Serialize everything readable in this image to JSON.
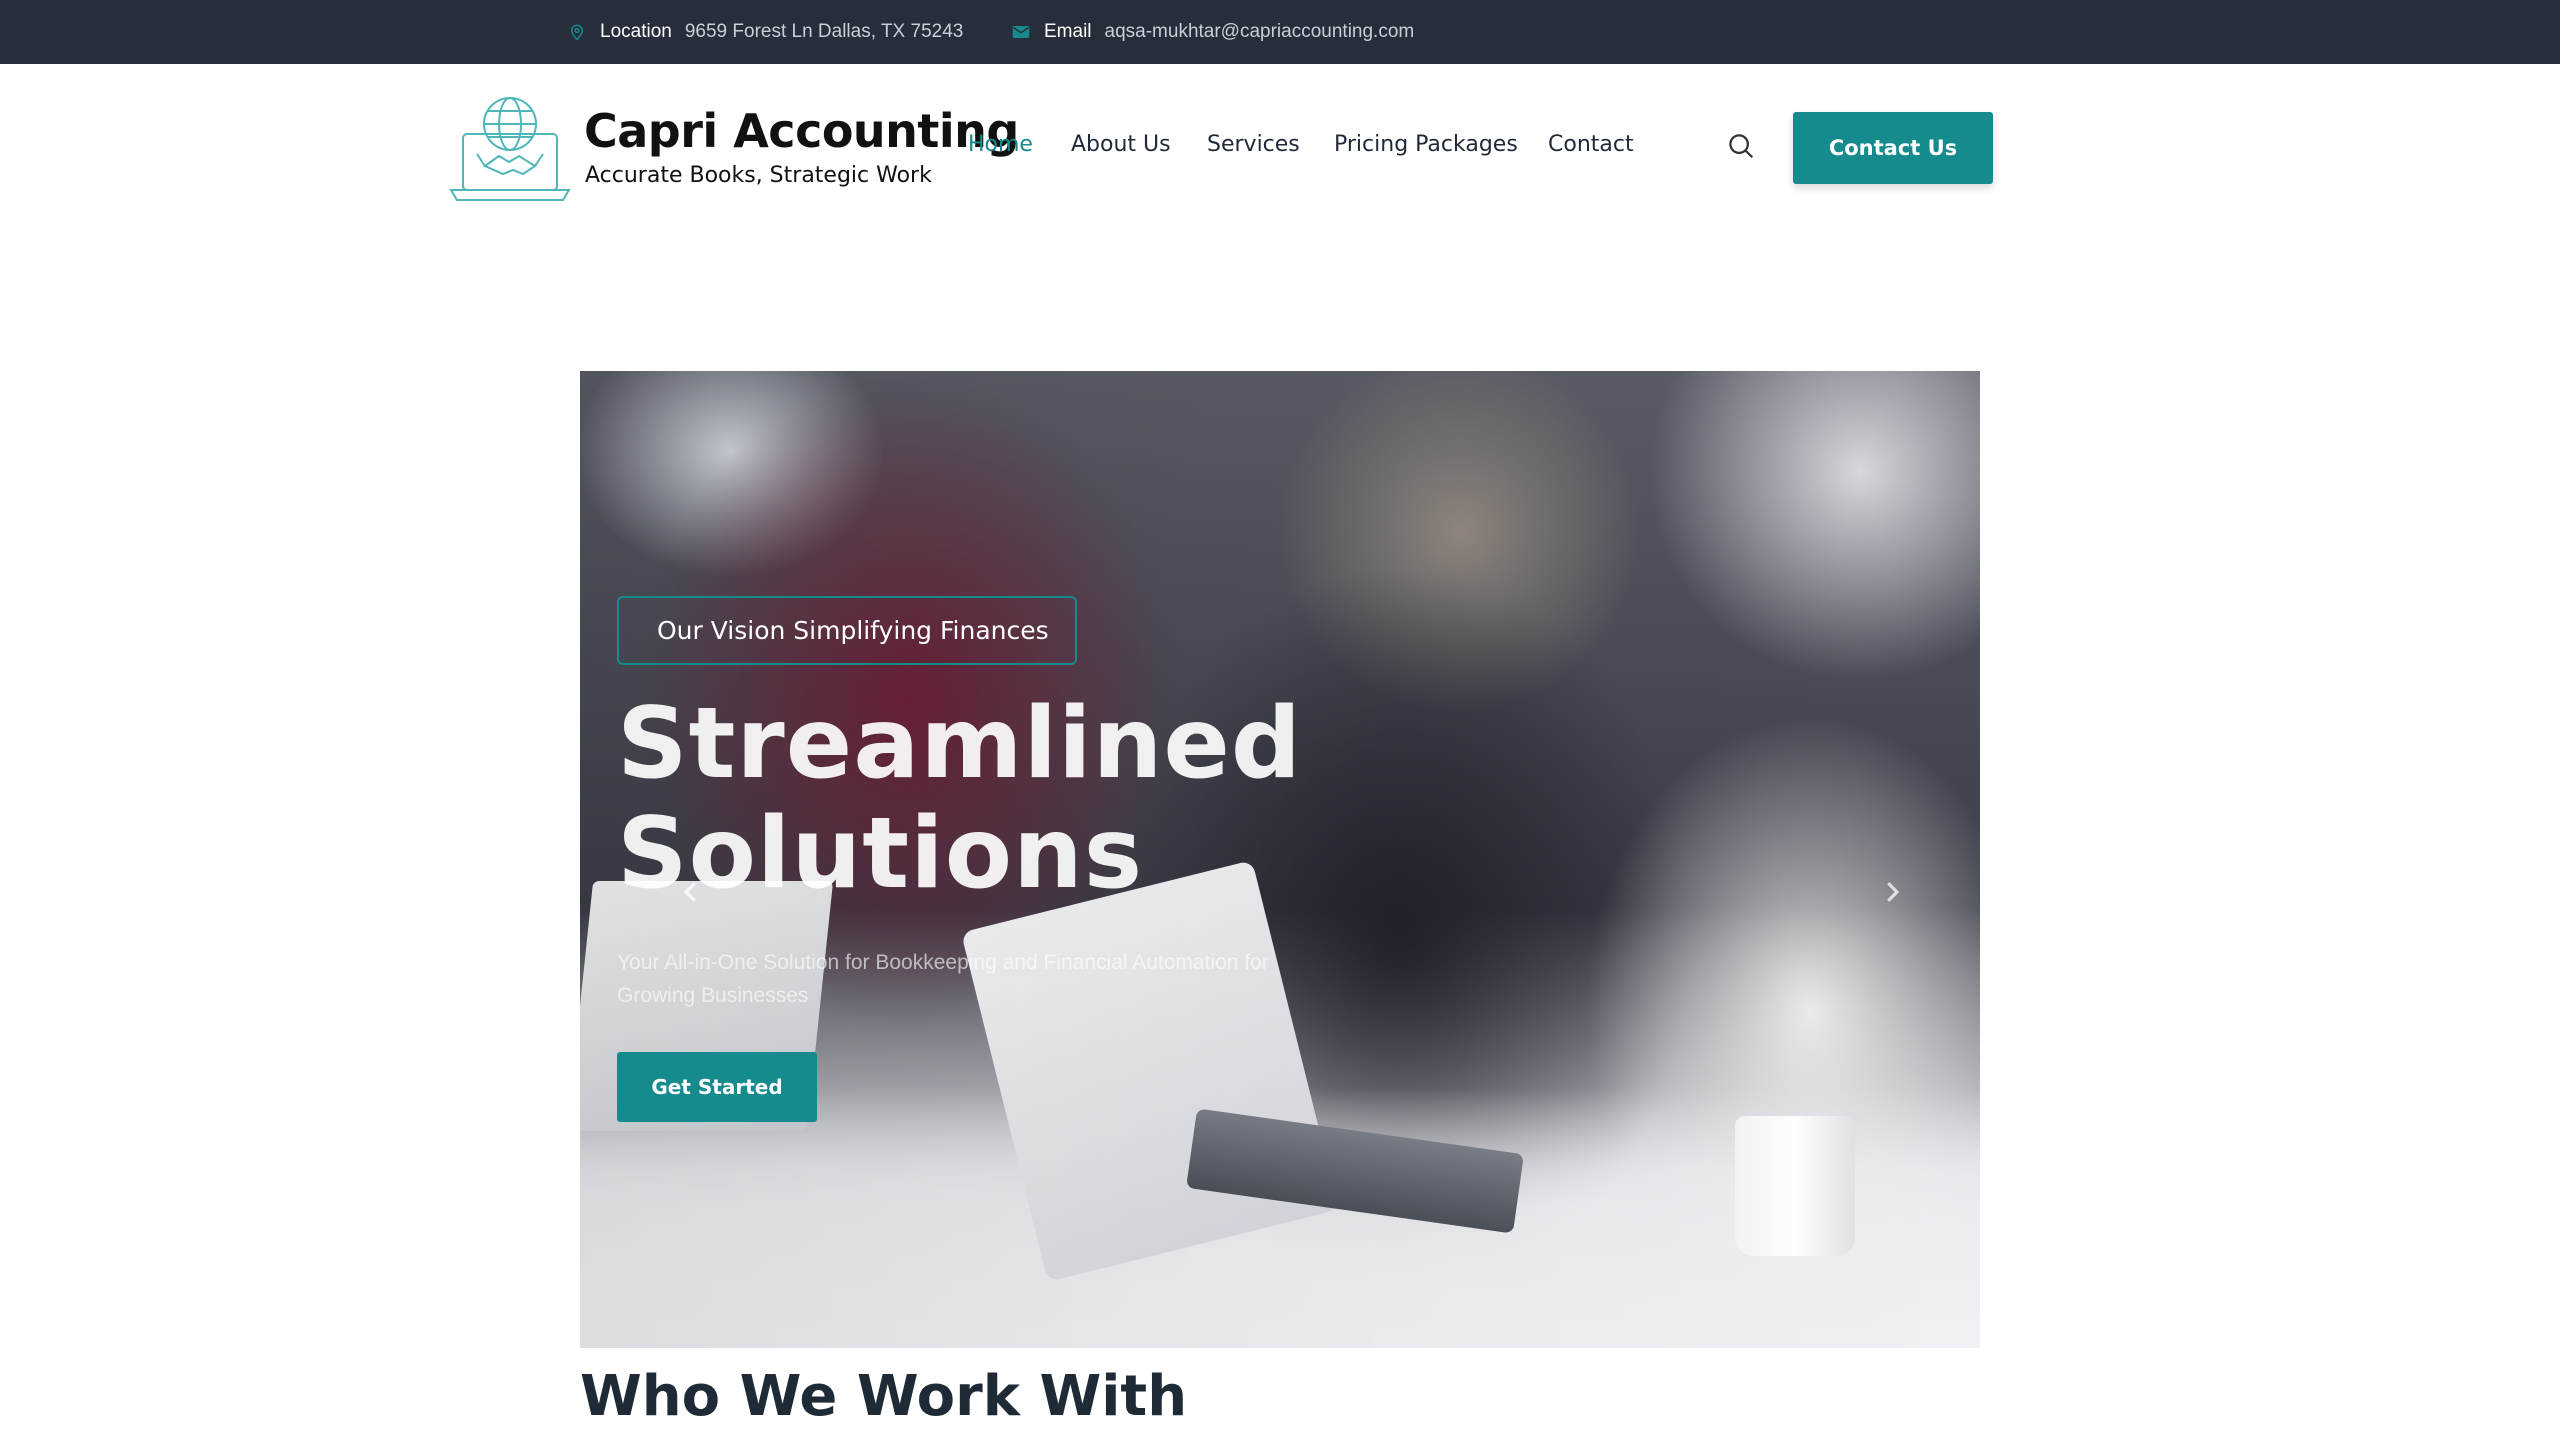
{
  "topbar": {
    "location_label": "Location",
    "location_value": "9659 Forest Ln Dallas, TX 75243",
    "email_label": "Email",
    "email_value": "aqsa-mukhtar@capriaccounting.com",
    "icons": [
      "map-pin-icon",
      "envelope-icon"
    ]
  },
  "brand": {
    "name": "Capri Accounting",
    "tagline": "Accurate Books, Strategic Work",
    "logo_icon": "globe-handshake-laptop-icon"
  },
  "nav": {
    "items": [
      {
        "label": "Home",
        "active": true
      },
      {
        "label": "About Us",
        "active": false
      },
      {
        "label": "Services",
        "active": false
      },
      {
        "label": "Pricing Packages",
        "active": false
      },
      {
        "label": "Contact",
        "active": false
      }
    ],
    "search_icon": "search-icon",
    "cta_label": "Contact Us"
  },
  "hero": {
    "badge": "Our Vision Simplifying Finances",
    "title_line1": "Streamlined",
    "title_line2": "Solutions",
    "subtitle": "Your All-in-One Solution for Bookkeeping and Financial Automation for Growing Businesses",
    "button_label": "Get Started",
    "prev_icon": "chevron-left-icon",
    "next_icon": "chevron-right-icon"
  },
  "sections": {
    "who_we_work_with": "Who We Work With"
  },
  "colors": {
    "accent": "#168b8d",
    "topbar_bg": "#272d3a",
    "text_dark": "#1e2a36"
  }
}
